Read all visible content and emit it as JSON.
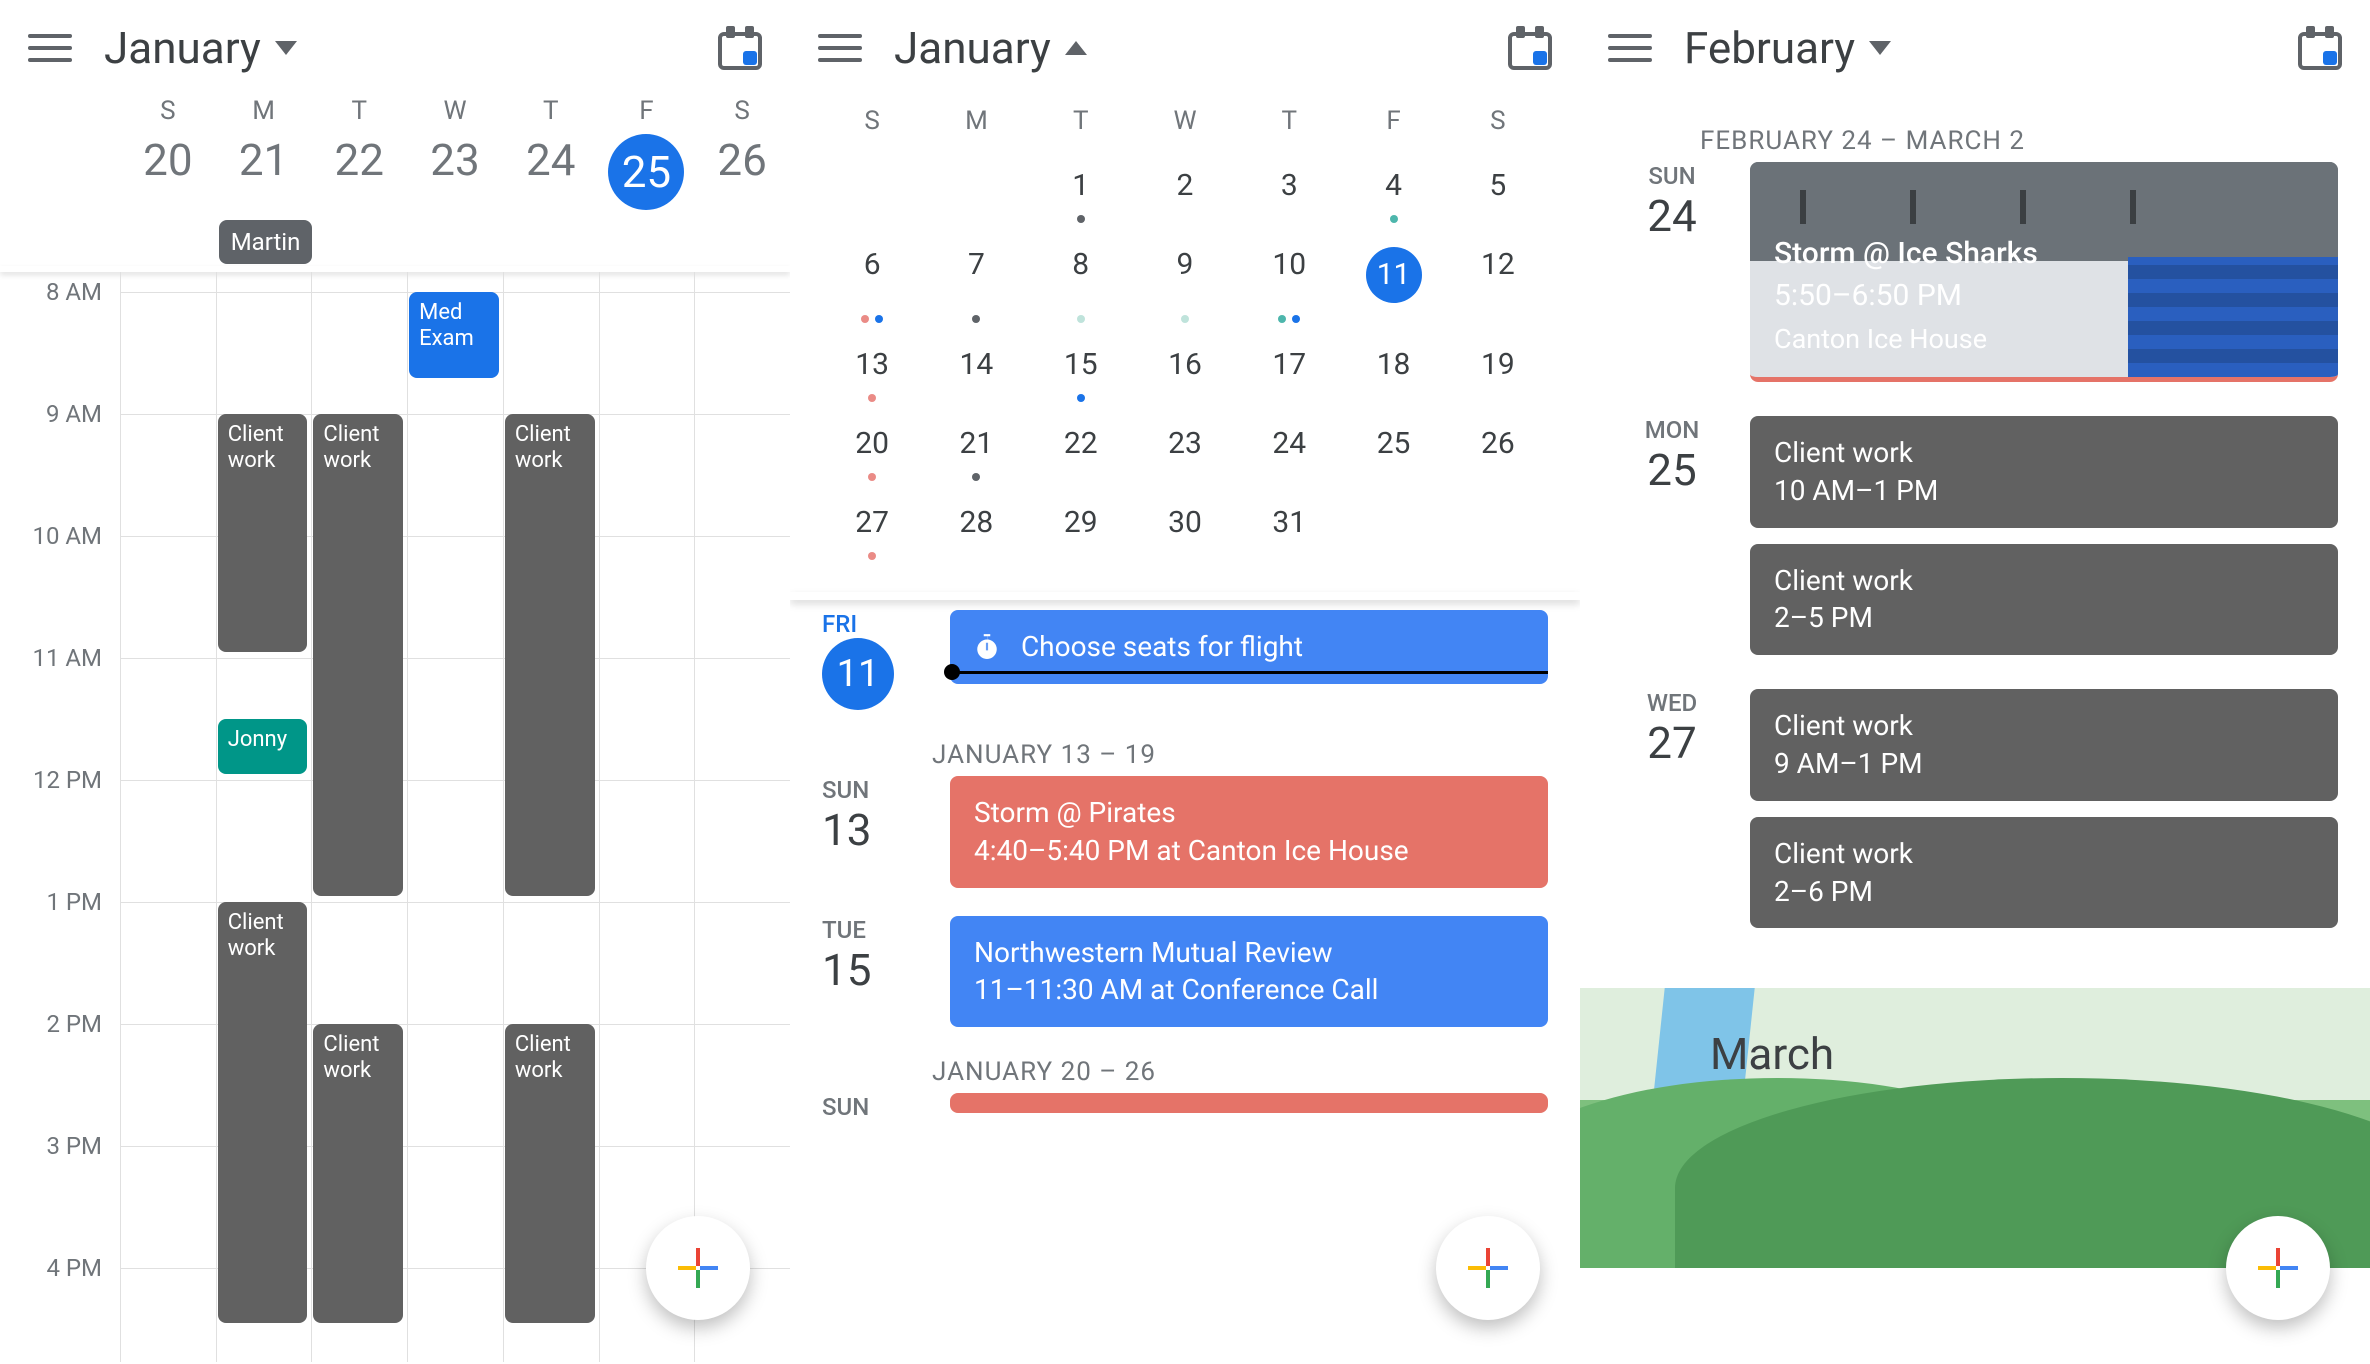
{
  "panel1": {
    "month": "January",
    "days": [
      {
        "dow": "S",
        "num": "20"
      },
      {
        "dow": "M",
        "num": "21"
      },
      {
        "dow": "T",
        "num": "22"
      },
      {
        "dow": "W",
        "num": "23"
      },
      {
        "dow": "T",
        "num": "24"
      },
      {
        "dow": "F",
        "num": "25",
        "today": true
      },
      {
        "dow": "S",
        "num": "26"
      }
    ],
    "allday": {
      "col": 2,
      "label": "Martin"
    },
    "hours": [
      "8 AM",
      "9 AM",
      "10 AM",
      "11 AM",
      "12 PM",
      "1 PM",
      "2 PM",
      "3 PM",
      "4 PM"
    ],
    "events": [
      {
        "id": "med-exam",
        "label": "Med Exam",
        "color": "blue",
        "col": 4,
        "start": 8,
        "end": 8.75
      },
      {
        "id": "cw1",
        "label": "Client work",
        "color": "gray",
        "col": 2,
        "start": 9,
        "end": 11
      },
      {
        "id": "cw2",
        "label": "Client work",
        "color": "gray",
        "col": 3,
        "start": 9,
        "end": 13
      },
      {
        "id": "cw3",
        "label": "Client work",
        "color": "gray",
        "col": 5,
        "start": 9,
        "end": 13
      },
      {
        "id": "jonny",
        "label": "Jonny",
        "color": "teal",
        "col": 2,
        "start": 11.5,
        "end": 12
      },
      {
        "id": "cw4",
        "label": "Client work",
        "color": "gray",
        "col": 2,
        "start": 13,
        "end": 16.5
      },
      {
        "id": "cw5",
        "label": "Client work",
        "color": "gray",
        "col": 3,
        "start": 14,
        "end": 16.5
      },
      {
        "id": "cw6",
        "label": "Client work",
        "color": "gray",
        "col": 5,
        "start": 14,
        "end": 16.5
      }
    ]
  },
  "panel2": {
    "month": "January",
    "dows": [
      "S",
      "M",
      "T",
      "W",
      "T",
      "F",
      "S"
    ],
    "grid": [
      [
        {
          "n": ""
        },
        {
          "n": ""
        },
        {
          "n": "1",
          "dots": [
            "gray"
          ]
        },
        {
          "n": "2"
        },
        {
          "n": "3"
        },
        {
          "n": "4",
          "dots": [
            "teal"
          ]
        },
        {
          "n": "5"
        }
      ],
      [
        {
          "n": "6",
          "dots": [
            "red",
            "blue"
          ]
        },
        {
          "n": "7",
          "dots": [
            "gray"
          ]
        },
        {
          "n": "8",
          "dots": [
            "lt"
          ]
        },
        {
          "n": "9",
          "dots": [
            "lt"
          ]
        },
        {
          "n": "10",
          "dots": [
            "teal",
            "blue"
          ]
        },
        {
          "n": "11",
          "selected": true
        },
        {
          "n": "12"
        }
      ],
      [
        {
          "n": "13",
          "dots": [
            "red"
          ]
        },
        {
          "n": "14"
        },
        {
          "n": "15",
          "dots": [
            "blue"
          ]
        },
        {
          "n": "16"
        },
        {
          "n": "17"
        },
        {
          "n": "18"
        },
        {
          "n": "19"
        }
      ],
      [
        {
          "n": "20",
          "dots": [
            "red"
          ]
        },
        {
          "n": "21",
          "dots": [
            "gray"
          ]
        },
        {
          "n": "22"
        },
        {
          "n": "23"
        },
        {
          "n": "24"
        },
        {
          "n": "25"
        },
        {
          "n": "26"
        }
      ],
      [
        {
          "n": "27",
          "dots": [
            "red"
          ]
        },
        {
          "n": "28"
        },
        {
          "n": "29"
        },
        {
          "n": "30"
        },
        {
          "n": "31"
        },
        {
          "n": ""
        },
        {
          "n": ""
        }
      ]
    ],
    "today": {
      "dow": "FRI",
      "num": "11"
    },
    "reminder": "Choose seats for flight",
    "range1": "JANUARY 13 – 19",
    "e1": {
      "dow": "SUN",
      "num": "13",
      "title": "Storm @ Pirates",
      "sub": "4:40–5:40 PM at Canton Ice House"
    },
    "e2": {
      "dow": "TUE",
      "num": "15",
      "title": "Northwestern Mutual Review",
      "sub": "11–11:30 AM at Conference Call"
    },
    "range2": "JANUARY 20 – 26",
    "e3": {
      "dow": "SUN"
    }
  },
  "panel3": {
    "month": "February",
    "range": "FEBRUARY 24 – MARCH 2",
    "d1": {
      "dow": "SUN",
      "num": "24",
      "title": "Storm @ Ice Sharks",
      "time": "5:50–6:50 PM",
      "loc": "Canton Ice House"
    },
    "d2": {
      "dow": "MON",
      "num": "25",
      "c1t": "Client work",
      "c1s": "10 AM–1 PM",
      "c2t": "Client work",
      "c2s": "2–5 PM"
    },
    "d3": {
      "dow": "WED",
      "num": "27",
      "c1t": "Client work",
      "c1s": "9 AM–1 PM",
      "c2t": "Client work",
      "c2s": "2–6 PM"
    },
    "nextMonth": "March"
  }
}
